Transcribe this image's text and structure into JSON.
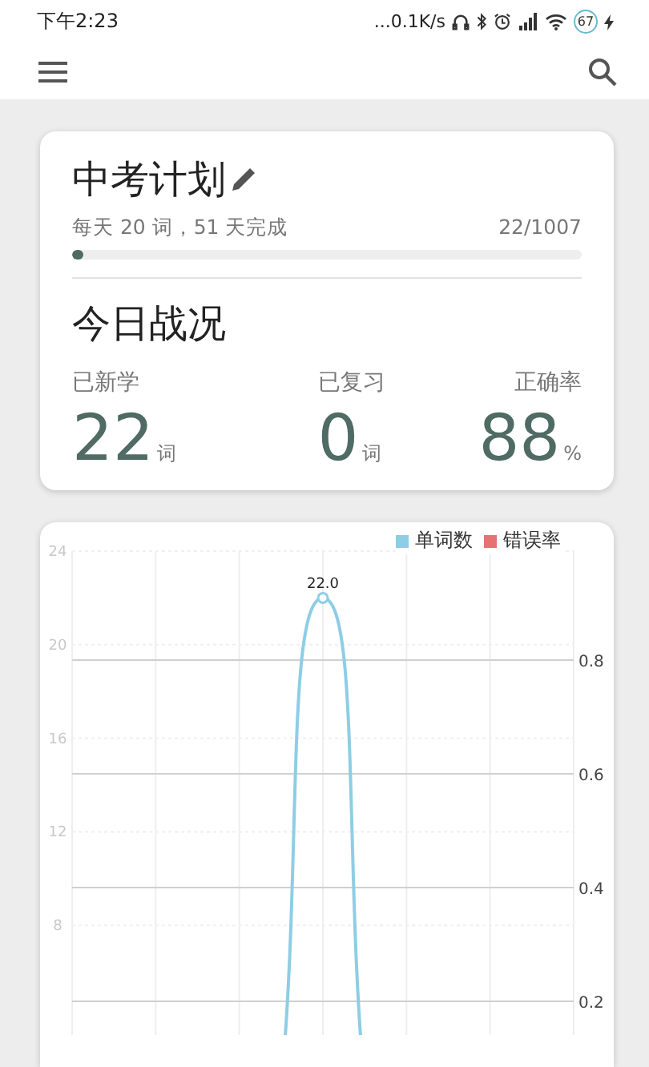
{
  "status_bar": {
    "time": "下午2:23",
    "speed": "...0.1K/s",
    "battery": "67"
  },
  "plan": {
    "title": "中考计划",
    "summary": "每天 20 词，51 天完成",
    "count": "22/1007",
    "level": 0.022
  },
  "today": {
    "title": "今日战况",
    "stats": [
      {
        "label": "已新学",
        "value": "22",
        "unit": "词"
      },
      {
        "label": "已复习",
        "value": "0",
        "unit": "词"
      },
      {
        "label": "正确率",
        "value": "88",
        "unit": "%"
      }
    ]
  },
  "chart": {
    "legend": [
      {
        "label": "单词数",
        "color": "#8ecde6"
      },
      {
        "label": "错误率",
        "color": "#e57373"
      }
    ],
    "left_ticks": [
      "24",
      "20",
      "16",
      "12",
      "8"
    ],
    "right_ticks": [
      "0.8",
      "0.6",
      "0.4",
      "0.2"
    ],
    "peak_label": "22.0"
  }
}
